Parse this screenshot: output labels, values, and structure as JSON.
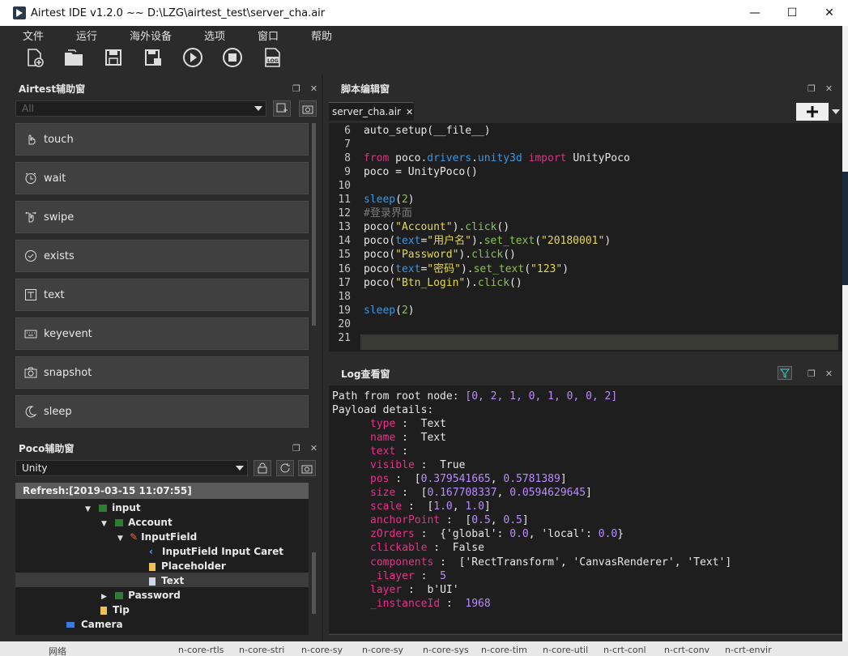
{
  "window": {
    "title": "Airtest IDE v1.2.0 ~~ D:\\LZG\\airtest_test\\server_cha.air",
    "min": "—",
    "max": "☐",
    "close": "✕"
  },
  "menu": [
    "文件",
    "运行",
    "海外设备",
    "选项",
    "窗口",
    "帮助"
  ],
  "toolbar_icons": [
    "new-file-icon",
    "open-folder-icon",
    "save-icon",
    "save-as-icon",
    "run-icon",
    "stop-icon",
    "log-icon"
  ],
  "airtest_panel": {
    "title": "Airtest辅助窗",
    "filter": "All",
    "buttons": [
      "touch",
      "wait",
      "swipe",
      "exists",
      "text",
      "keyevent",
      "snapshot",
      "sleep"
    ]
  },
  "poco_panel": {
    "title": "Poco辅助窗",
    "mode": "Unity",
    "refresh": "Refresh:[2019-03-15 11:07:55]",
    "tree": [
      {
        "label": "input",
        "depth": 0,
        "icon": "image",
        "expanded": true
      },
      {
        "label": "Account",
        "depth": 1,
        "icon": "image",
        "expanded": true
      },
      {
        "label": "InputField",
        "depth": 2,
        "icon": "pen",
        "expanded": true
      },
      {
        "label": "InputField Input Caret",
        "depth": 3,
        "icon": "caret"
      },
      {
        "label": "Placeholder",
        "depth": 3,
        "icon": "text"
      },
      {
        "label": "Text",
        "depth": 3,
        "icon": "text",
        "selected": true
      },
      {
        "label": "Password",
        "depth": 1,
        "icon": "image",
        "expanded": false
      },
      {
        "label": "Tip",
        "depth": 0,
        "icon": "text"
      },
      {
        "label": "Camera",
        "depth": -1,
        "icon": "camera"
      }
    ]
  },
  "editor": {
    "title": "脚本编辑窗",
    "tab": "server_cha.air",
    "tab_close": "✕",
    "lines": [
      {
        "n": "6",
        "t": [
          [
            "wh",
            "auto_setup(__file__)"
          ]
        ]
      },
      {
        "n": "7",
        "t": []
      },
      {
        "n": "8",
        "t": [
          [
            "kw",
            "from"
          ],
          [
            "wh",
            " poco."
          ],
          [
            "bl",
            "drivers"
          ],
          [
            "wh",
            "."
          ],
          [
            "bl",
            "unity3d"
          ],
          [
            "wh",
            " "
          ],
          [
            "kw",
            "import"
          ],
          [
            "wh",
            " UnityPoco"
          ]
        ]
      },
      {
        "n": "9",
        "t": [
          [
            "wh",
            "poco = UnityPoco()"
          ]
        ]
      },
      {
        "n": "10",
        "t": []
      },
      {
        "n": "11",
        "t": [
          [
            "bl",
            "sleep"
          ],
          [
            "wh",
            "("
          ],
          [
            "gr",
            "2"
          ],
          [
            "wh",
            ")"
          ]
        ]
      },
      {
        "n": "12",
        "t": [
          [
            "cm",
            "#登录界面"
          ]
        ]
      },
      {
        "n": "13",
        "t": [
          [
            "wh",
            "poco("
          ],
          [
            "yl",
            "\"Account\""
          ],
          [
            "wh",
            ")."
          ],
          [
            "gr",
            "click"
          ],
          [
            "wh",
            "()"
          ]
        ]
      },
      {
        "n": "14",
        "t": [
          [
            "wh",
            "poco("
          ],
          [
            "bl",
            "text"
          ],
          [
            "wh",
            "="
          ],
          [
            "yl",
            "\"用户名\""
          ],
          [
            "wh",
            ")."
          ],
          [
            "gr",
            "set_text"
          ],
          [
            "wh",
            "("
          ],
          [
            "yl",
            "\"20180001\""
          ],
          [
            "wh",
            ")"
          ]
        ]
      },
      {
        "n": "15",
        "t": [
          [
            "wh",
            "poco("
          ],
          [
            "yl",
            "\"Password\""
          ],
          [
            "wh",
            ")."
          ],
          [
            "gr",
            "click"
          ],
          [
            "wh",
            "()"
          ]
        ]
      },
      {
        "n": "16",
        "t": [
          [
            "wh",
            "poco("
          ],
          [
            "bl",
            "text"
          ],
          [
            "wh",
            "="
          ],
          [
            "yl",
            "\"密码\""
          ],
          [
            "wh",
            ")."
          ],
          [
            "gr",
            "set_text"
          ],
          [
            "wh",
            "("
          ],
          [
            "yl",
            "\"123\""
          ],
          [
            "wh",
            ")"
          ]
        ]
      },
      {
        "n": "17",
        "t": [
          [
            "wh",
            "poco("
          ],
          [
            "yl",
            "\"Btn_Login\""
          ],
          [
            "wh",
            ")."
          ],
          [
            "gr",
            "click"
          ],
          [
            "wh",
            "()"
          ]
        ]
      },
      {
        "n": "18",
        "t": []
      },
      {
        "n": "19",
        "t": [
          [
            "bl",
            "sleep"
          ],
          [
            "wh",
            "("
          ],
          [
            "gr",
            "2"
          ],
          [
            "wh",
            ")"
          ]
        ]
      },
      {
        "n": "20",
        "t": []
      },
      {
        "n": "21",
        "t": []
      }
    ]
  },
  "log": {
    "title": "Log查看窗",
    "path_label": "Path from root node: ",
    "path_value": "[0, 2, 1, 0, 1, 0, 0, 2]",
    "payload_label": "Payload details:",
    "fields": [
      {
        "key": "type",
        "sep": " :  ",
        "val": "Text",
        "color": "wh"
      },
      {
        "key": "name",
        "sep": " :  ",
        "val": "Text",
        "color": "wh"
      },
      {
        "key": "text",
        "sep": " : ",
        "val": "",
        "color": "wh"
      },
      {
        "key": "visible",
        "sep": " :  ",
        "val": "True",
        "color": "wh"
      },
      {
        "key": "pos",
        "sep": " :  ",
        "val": "[0.379541665, 0.5781389]",
        "color": "mix"
      },
      {
        "key": "size",
        "sep": " :  ",
        "val": "[0.167708337, 0.0594629645]",
        "color": "mix"
      },
      {
        "key": "scale",
        "sep": " :  ",
        "val": "[1.0, 1.0]",
        "color": "mix"
      },
      {
        "key": "anchorPoint",
        "sep": " :  ",
        "val": "[0.5, 0.5]",
        "color": "mix"
      },
      {
        "key": "zOrders",
        "sep": " :  ",
        "val": "{'global': 0.0, 'local': 0.0}",
        "color": "mix"
      },
      {
        "key": "clickable",
        "sep": " :  ",
        "val": "False",
        "color": "wh"
      },
      {
        "key": "components",
        "sep": " :  ",
        "val": "['RectTransform', 'CanvasRenderer', 'Text']",
        "color": "wh"
      },
      {
        "key": "_ilayer",
        "sep": " :  ",
        "val": "5",
        "color": "n"
      },
      {
        "key": "layer",
        "sep": " :  ",
        "val": "b'UI'",
        "color": "wh"
      },
      {
        "key": "_instanceId",
        "sep": " :  ",
        "val": "1968",
        "color": "n"
      }
    ]
  },
  "taskbar": [
    "网络",
    "n-core-rtls",
    "n-core-stri",
    "n-core-sy",
    "n-core-sy",
    "n-core-sys",
    "n-core-tim",
    "n-core-util",
    "n-crt-conl",
    "n-crt-conv",
    "n-crt-envir"
  ]
}
